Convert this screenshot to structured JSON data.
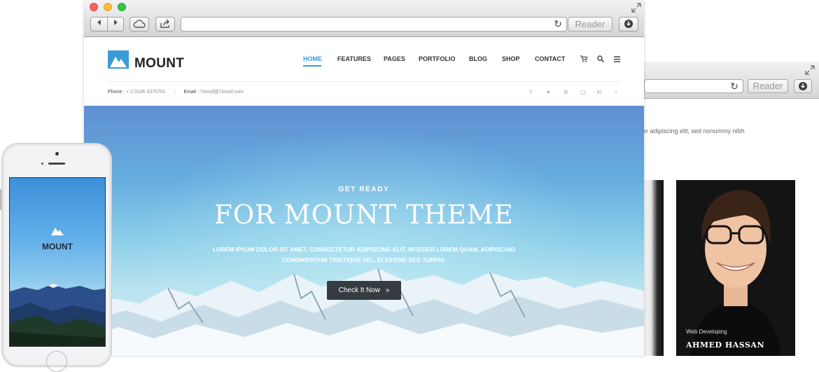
{
  "back_window": {
    "reader_label": "Reader",
    "body_text": "er adipiscing elit, sed nonummy nibh",
    "team_member": {
      "role": "Web Developing",
      "name": "AHMED HASSAN"
    }
  },
  "browser": {
    "reader_label": "Reader"
  },
  "site": {
    "logo_text": "MOUNT",
    "menu": [
      {
        "label": "HOME",
        "active": true
      },
      {
        "label": "FEATURES",
        "active": false
      },
      {
        "label": "PAGES",
        "active": false
      },
      {
        "label": "PORTFOLIO",
        "active": false
      },
      {
        "label": "BLOG",
        "active": false
      },
      {
        "label": "SHOP",
        "active": false
      },
      {
        "label": "CONTACT",
        "active": false
      }
    ],
    "header_icons": [
      "cart-icon",
      "search-icon",
      "menu-icon"
    ],
    "contact": {
      "phone_label": "Phone :",
      "phone_value": "+ 2 0106 5370701",
      "email_label": "Email :",
      "email_value": "7oroof@7oroof.com"
    },
    "social_icons": [
      "facebook-icon",
      "twitter-icon",
      "pinterest-icon",
      "vimeo-icon",
      "linkedin-icon",
      "rss-icon"
    ],
    "hero": {
      "kicker": "GET READY",
      "title": "FOR MOUNT THEME",
      "description_line1": "LOREM IPSUM DOLOR SIT AMET, CONSECTETUR ADIPISCING ELIT. INTEGER LOREM QUAM, ADIPISCING",
      "description_line2": "CONDIMENTUM TRISTIQUE VEL, ELEIFEND SED TURPIS.",
      "button_label": "Check It Now",
      "slide_count": 2,
      "active_slide": 1
    }
  },
  "phone": {
    "logo_text": "MOUNT"
  },
  "colors": {
    "accent": "#3a9bd9",
    "button_dark": "#353b40",
    "traffic_red": "#fc605b",
    "traffic_yellow": "#fdbc40",
    "traffic_green": "#34c84a"
  }
}
